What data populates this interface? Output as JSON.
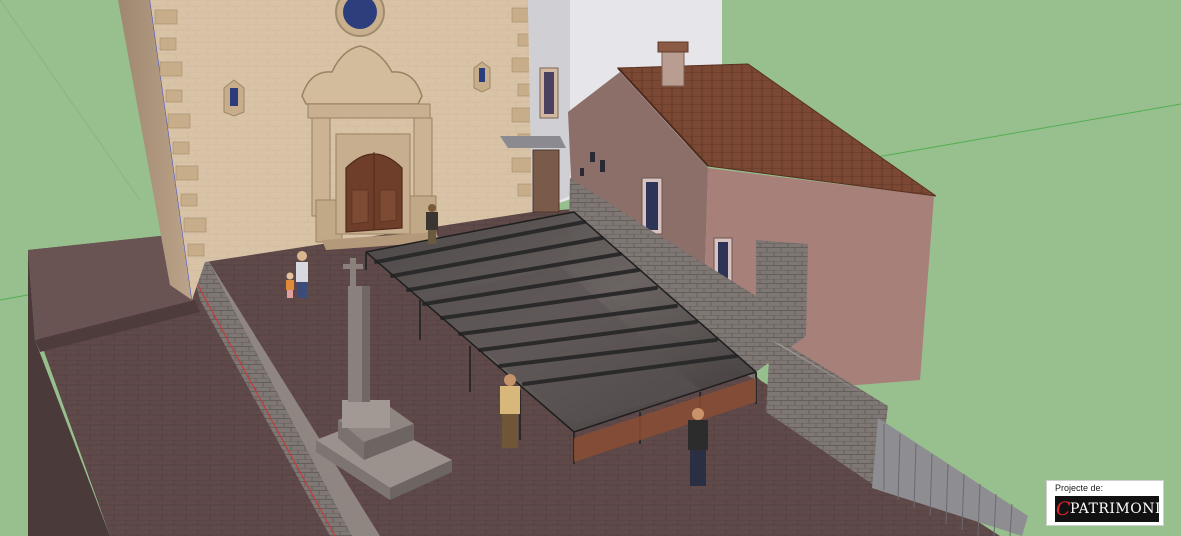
{
  "credit": {
    "caption": "Projecte de:",
    "logo_mark": "C",
    "logo_name": "PATRIMONI"
  },
  "scene": {
    "ground_color": "#97c08e",
    "plaza_color": "#5c4747",
    "church_facade_color": "#d9c4a9",
    "roof_tile_color": "#7a4732",
    "glass_roof_color": "#3a3a3a",
    "stone_wall_color": "#7d7673"
  }
}
